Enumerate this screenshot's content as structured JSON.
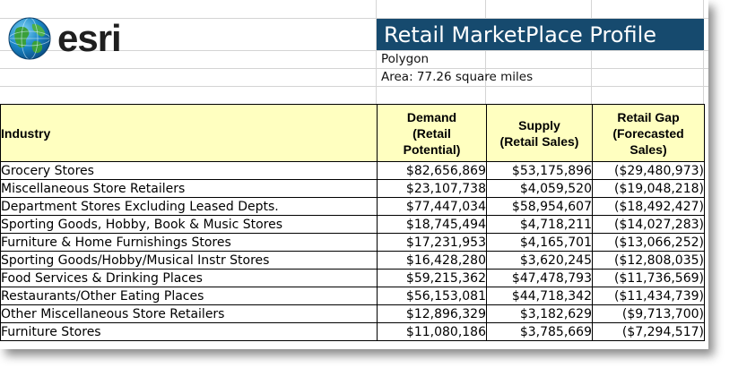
{
  "logo": {
    "text": "esri",
    "icon": "globe-icon"
  },
  "header": {
    "title": "Retail MarketPlace Profile",
    "geography": "Polygon",
    "area": "Area: 77.26 square miles"
  },
  "table": {
    "headers": {
      "industry": "Industry",
      "demand": [
        "Demand",
        "(Retail",
        "Potential)"
      ],
      "supply": [
        "Supply",
        "(Retail Sales)"
      ],
      "gap": [
        "Retail Gap",
        "(Forecasted",
        "Sales)"
      ]
    },
    "rows": [
      {
        "industry": "Grocery Stores",
        "demand": "$82,656,869",
        "supply": "$53,175,896",
        "gap": "($29,480,973)"
      },
      {
        "industry": "Miscellaneous Store Retailers",
        "demand": "$23,107,738",
        "supply": "$4,059,520",
        "gap": "($19,048,218)"
      },
      {
        "industry": "Department Stores Excluding Leased Depts.",
        "demand": "$77,447,034",
        "supply": "$58,954,607",
        "gap": "($18,492,427)"
      },
      {
        "industry": "Sporting Goods, Hobby, Book & Music Stores",
        "demand": "$18,745,494",
        "supply": "$4,718,211",
        "gap": "($14,027,283)"
      },
      {
        "industry": "Furniture & Home Furnishings Stores",
        "demand": "$17,231,953",
        "supply": "$4,165,701",
        "gap": "($13,066,252)"
      },
      {
        "industry": "Sporting Goods/Hobby/Musical Instr Stores",
        "demand": "$16,428,280",
        "supply": "$3,620,245",
        "gap": "($12,808,035)"
      },
      {
        "industry": "Food Services & Drinking Places",
        "demand": "$59,215,362",
        "supply": "$47,478,793",
        "gap": "($11,736,569)"
      },
      {
        "industry": "Restaurants/Other Eating Places",
        "demand": "$56,153,081",
        "supply": "$44,718,342",
        "gap": "($11,434,739)"
      },
      {
        "industry": "Other Miscellaneous Store Retailers",
        "demand": "$12,896,329",
        "supply": "$3,182,629",
        "gap": "($9,713,700)"
      },
      {
        "industry": "Furniture Stores",
        "demand": "$11,080,186",
        "supply": "$3,785,669",
        "gap": "($7,294,517)"
      }
    ]
  },
  "colors": {
    "title_bar": "#164a6e",
    "header_fill": "#ffffc0",
    "negative_text": "#e00000"
  }
}
